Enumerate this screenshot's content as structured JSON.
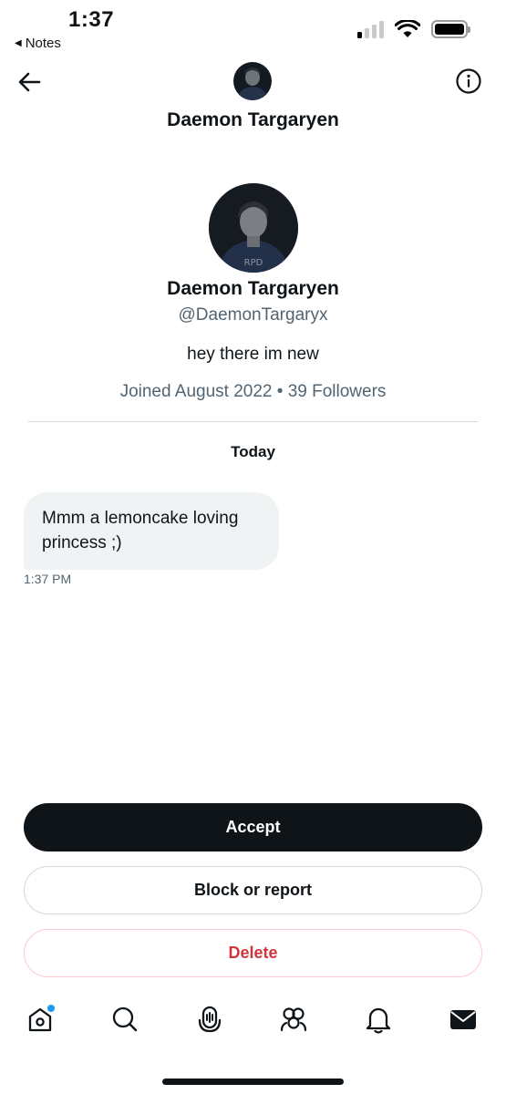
{
  "status_bar": {
    "time": "1:37",
    "back_app": "Notes"
  },
  "header": {
    "title": "Daemon Targaryen"
  },
  "profile": {
    "name": "Daemon Targaryen",
    "handle": "@DaemonTargaryx",
    "bio": "hey there im new",
    "meta": "Joined August 2022 • 39 Followers"
  },
  "conversation": {
    "day_label": "Today",
    "messages": [
      {
        "text": "Mmm a lemoncake loving princess ;)",
        "time": "1:37 PM"
      }
    ]
  },
  "actions": {
    "accept": "Accept",
    "block": "Block or report",
    "delete": "Delete"
  },
  "tabbar": {
    "items": [
      "home-icon",
      "search-icon",
      "spaces-icon",
      "communities-icon",
      "notifications-icon",
      "messages-icon"
    ],
    "active": "messages-icon"
  },
  "colors": {
    "accent": "#1d9bf0",
    "text": "#0f1419",
    "secondary_text": "#536471",
    "danger": "#d0353e",
    "bubble": "#eff3f4"
  }
}
